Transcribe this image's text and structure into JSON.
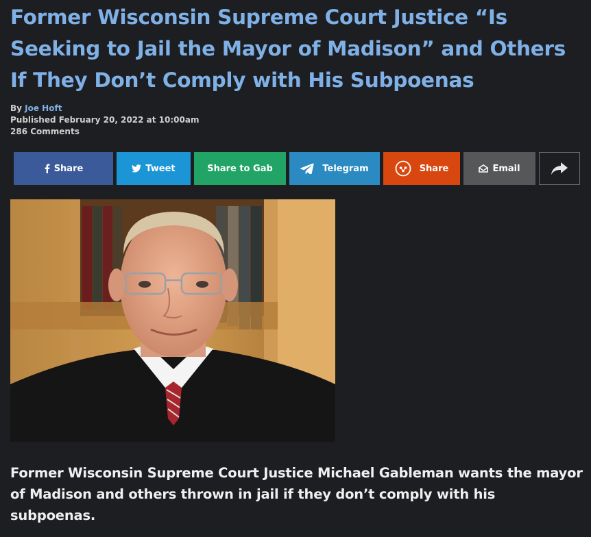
{
  "article": {
    "title": "Former Wisconsin Supreme Court Justice “Is Seeking to Jail the Mayor of Madison” and Others If They Don’t Comply with His Subpoenas",
    "by_label": "By",
    "author": "Joe Hoft",
    "published": "Published February 20, 2022 at 10:00am",
    "comments": "286 Comments",
    "lede": "Former Wisconsin Supreme Court Justice Michael Gableman wants the mayor of Madison and others thrown in jail if they don’t comply with his subpoenas."
  },
  "share_bar": {
    "facebook": {
      "label": "Share",
      "icon": "facebook-icon",
      "color": "#3a5a99"
    },
    "twitter": {
      "label": "Tweet",
      "icon": "twitter-icon",
      "color": "#1b95d6"
    },
    "gab": {
      "label": "Share to Gab",
      "color": "#21a465"
    },
    "telegram": {
      "label": "Telegram",
      "icon": "telegram-icon",
      "color": "#2a8ac1"
    },
    "share": {
      "label": "Share",
      "icon": "share-icon",
      "color": "#d7470f"
    },
    "email": {
      "label": "Email",
      "icon": "envelope-icon",
      "color": "#555759"
    },
    "more": {
      "icon": "forward-arrow-icon"
    }
  },
  "colors": {
    "background": "#1d1e21",
    "title": "#7fb0e6",
    "text": "#f0f0f0"
  }
}
